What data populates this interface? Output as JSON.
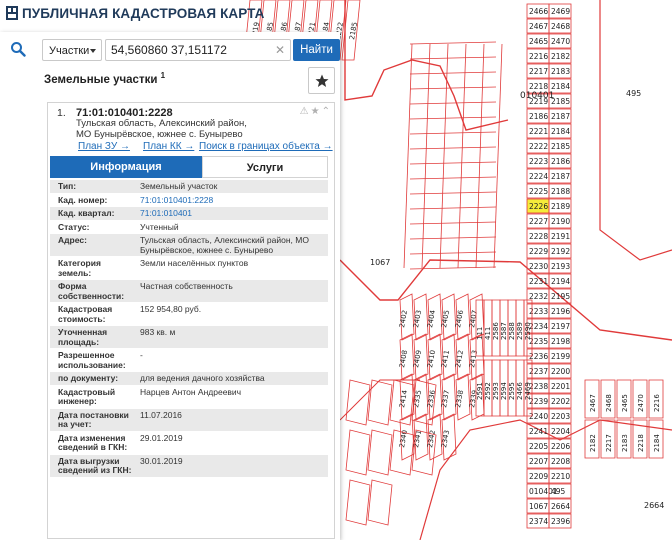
{
  "app": {
    "title": "ПУБЛИЧНАЯ КАДАСТРОВАЯ КАРТА"
  },
  "search": {
    "type_label": "Участки",
    "query": "54,560860 37,151172",
    "clear_symbol": "✕",
    "button_label": "Найти"
  },
  "section": {
    "title": "Земельные участки",
    "count": "1"
  },
  "card": {
    "index": "1.",
    "cad_number": "71:01:010401:2228",
    "address": "Тульская область, Алексинский район, МО Бунырёвское, южнее с. Бунырево",
    "link_plan_zu": "План ЗУ →",
    "link_plan_kk": "План КК →",
    "link_search_bounds": "Поиск в границах объекта →",
    "tab_info": "Информация",
    "tab_services": "Услуги",
    "rows": [
      {
        "label": "Тип:",
        "value": "Земельный участок"
      },
      {
        "label": "Кад. номер:",
        "value": "71:01:010401:2228"
      },
      {
        "label": "Кад. квартал:",
        "value": "71:01:010401"
      },
      {
        "label": "Статус:",
        "value": "Учтенный"
      },
      {
        "label": "Адрес:",
        "value": "Тульская область, Алексинский район, МО Бунырёвское, южнее с. Бунырево"
      },
      {
        "label": "Категория земель:",
        "value": "Земли населённых пунктов"
      },
      {
        "label": "Форма собственности:",
        "value": "Частная собственность"
      },
      {
        "label": "Кадастровая стоимость:",
        "value": "152 954,80 руб."
      },
      {
        "label": "Уточненная площадь:",
        "value": "983 кв. м"
      },
      {
        "label": "Разрешенное использование:",
        "value": "-"
      },
      {
        "label": "по документу:",
        "value": "для ведения дачного хозяйства"
      },
      {
        "label": "Кадастровый инженер:",
        "value": "Нарцев Антон Андреевич"
      },
      {
        "label": "Дата постановки на учет:",
        "value": "11.07.2016"
      },
      {
        "label": "Дата изменения сведений в ГКН:",
        "value": "29.01.2019"
      },
      {
        "label": "Дата выгрузки сведений из ГКН:",
        "value": "30.01.2019"
      }
    ]
  },
  "map_labels": [
    "2466",
    "2469",
    "2467",
    "2468",
    "2465",
    "2470",
    "2216",
    "2182",
    "2217",
    "2183",
    "2218",
    "2184",
    "2219",
    "2185",
    "2186",
    "2187",
    "2221",
    "2184",
    "2222",
    "2185",
    "2223",
    "2186",
    "2224",
    "2187",
    "2225",
    "2188",
    "2226",
    "2189",
    "2227",
    "2190",
    "2228",
    "2191",
    "2229",
    "2192",
    "2230",
    "2193",
    "2231",
    "2194",
    "2232",
    "2195",
    "2233",
    "2196",
    "2234",
    "2197",
    "2235",
    "2198",
    "2236",
    "2199",
    "2237",
    "2200",
    "2238",
    "2201",
    "2239",
    "2202",
    "2240",
    "2203",
    "2241",
    "2204",
    "2205",
    "2206",
    "2207",
    "2208",
    "2209",
    "2210",
    "010401",
    "495",
    "1067",
    "2664",
    "2374",
    "2396",
    "2402",
    "2403",
    "2404",
    "2405",
    "2406",
    "2407",
    "2408",
    "2409",
    "2410",
    "2411",
    "2412",
    "2413",
    "2414",
    "2335",
    "2336",
    "2337",
    "2338",
    "2339",
    "2340",
    "2341",
    "2342",
    "2343",
    "111",
    "411",
    "2586",
    "2587",
    "2588",
    "2589",
    "2590",
    "2591",
    "2592",
    "2593",
    "2594",
    "2595"
  ],
  "colors": {
    "accent": "#1e6bb8",
    "parcel_line": "#e03a3a",
    "highlight": "#f5ec3a"
  },
  "icons": {
    "search": "search-icon",
    "star": "star-icon",
    "warning": "warning-icon",
    "chevron": "chevron-up-icon"
  }
}
